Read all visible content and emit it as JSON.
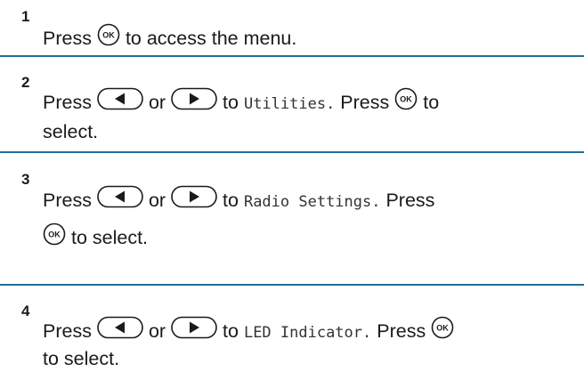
{
  "steps": [
    {
      "number": "1",
      "line1": {
        "pre": "Press",
        "post": "to access the menu."
      }
    },
    {
      "number": "2",
      "line1": {
        "press": "Press",
        "or": "or",
        "to": "to",
        "menu": "Utilities.",
        "press2": "Press",
        "to2": "to"
      },
      "line2": "select."
    },
    {
      "number": "3",
      "line1": {
        "press": "Press",
        "or": "or",
        "to": "to",
        "menu": "Radio Settings.",
        "press2": "Press"
      },
      "line2": "to select."
    },
    {
      "number": "4",
      "line1": {
        "press": "Press",
        "or": "or",
        "to": "to",
        "menu": "LED Indicator.",
        "press2": "Press"
      },
      "line2": "to select."
    }
  ],
  "icons": {
    "ok": "ok-button-icon",
    "left": "left-arrow-button-icon",
    "right": "right-arrow-button-icon"
  },
  "colors": {
    "divider": "#1f6f98",
    "text": "#1a1a1a"
  }
}
